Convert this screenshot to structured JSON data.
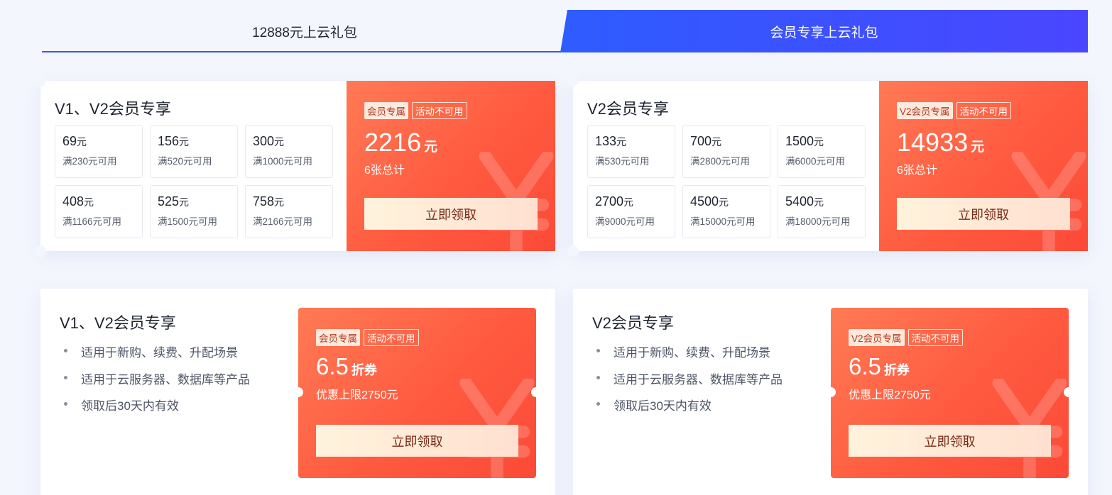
{
  "tabs": [
    {
      "label": "12888元上云礼包",
      "active": false
    },
    {
      "label": "会员专享上云礼包",
      "active": true
    }
  ],
  "coupon_packs": [
    {
      "title": "V1、V2会员专享",
      "coupons": [
        {
          "amount": "69",
          "unit": "元",
          "condition": "满230元可用"
        },
        {
          "amount": "156",
          "unit": "元",
          "condition": "满520元可用"
        },
        {
          "amount": "300",
          "unit": "元",
          "condition": "满1000元可用"
        },
        {
          "amount": "408",
          "unit": "元",
          "condition": "满1166元可用"
        },
        {
          "amount": "525",
          "unit": "元",
          "condition": "满1500元可用"
        },
        {
          "amount": "758",
          "unit": "元",
          "condition": "满2166元可用"
        }
      ],
      "tag_primary": "会员专属",
      "tag_secondary": "活动不可用",
      "total": "2216",
      "total_unit": "元",
      "total_note": "6张总计",
      "button": "立即领取"
    },
    {
      "title": "V2会员专享",
      "coupons": [
        {
          "amount": "133",
          "unit": "元",
          "condition": "满530元可用"
        },
        {
          "amount": "700",
          "unit": "元",
          "condition": "满2800元可用"
        },
        {
          "amount": "1500",
          "unit": "元",
          "condition": "满6000元可用"
        },
        {
          "amount": "2700",
          "unit": "元",
          "condition": "满9000元可用"
        },
        {
          "amount": "4500",
          "unit": "元",
          "condition": "满15000元可用"
        },
        {
          "amount": "5400",
          "unit": "元",
          "condition": "满18000元可用"
        }
      ],
      "tag_primary": "V2会员专属",
      "tag_secondary": "活动不可用",
      "total": "14933",
      "total_unit": "元",
      "total_note": "6张总计",
      "button": "立即领取"
    }
  ],
  "discount_offers": [
    {
      "title": "V1、V2会员专享",
      "bullets": [
        "适用于新购、续费、升配场景",
        "适用于云服务器、数据库等产品",
        "领取后30天内有效"
      ],
      "tag_primary": "会员专属",
      "tag_secondary": "活动不可用",
      "discount": "6.5",
      "discount_unit": "折券",
      "limit_note": "优惠上限2750元",
      "button": "立即领取"
    },
    {
      "title": "V2会员专享",
      "bullets": [
        "适用于新购、续费、升配场景",
        "适用于云服务器、数据库等产品",
        "领取后30天内有效"
      ],
      "tag_primary": "V2会员专属",
      "tag_secondary": "活动不可用",
      "discount": "6.5",
      "discount_unit": "折券",
      "limit_note": "优惠上限2750元",
      "button": "立即领取"
    }
  ],
  "colors": {
    "accent_blue": "#3d52ff",
    "coupon_red": "#ff5a40",
    "button_cream": "#fff3dc"
  }
}
